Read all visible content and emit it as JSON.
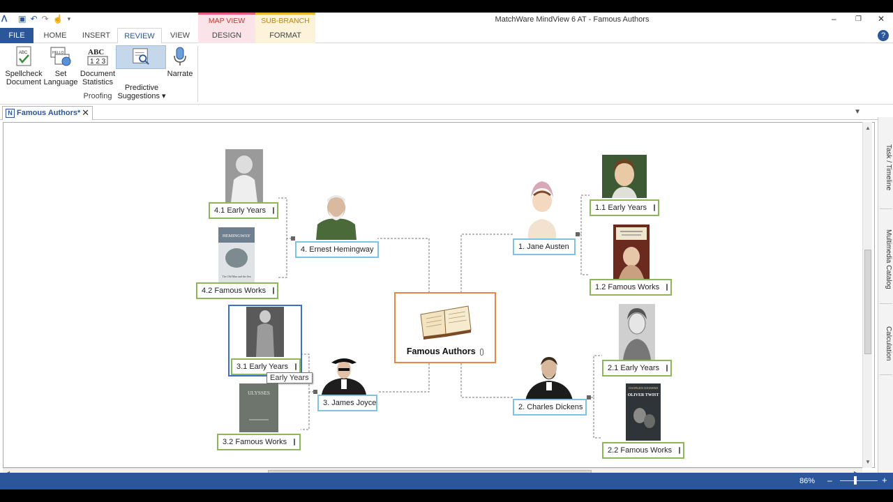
{
  "window": {
    "title": "MatchWare MindView 6 AT - Famous Authors",
    "context_tabs": {
      "map_view": "MAP VIEW",
      "sub_branch": "SUB-BRANCH"
    }
  },
  "ribbon_tabs": [
    "FILE",
    "HOME",
    "INSERT",
    "REVIEW",
    "VIEW",
    "DESIGN",
    "FORMAT"
  ],
  "ribbon": {
    "buttons": [
      {
        "line1": "Spellcheck",
        "line2": "Document",
        "icon": "spellcheck-icon"
      },
      {
        "line1": "Set",
        "line2": "Language",
        "icon": "language-icon"
      },
      {
        "line1": "Document",
        "line2": "Statistics",
        "icon": "statistics-icon"
      },
      {
        "line1": "Predictive",
        "line2": "Suggestions ▾",
        "icon": "predictive-icon"
      },
      {
        "line1": "Narrate",
        "line2": "",
        "icon": "microphone-icon"
      }
    ],
    "group_label": "Proofing"
  },
  "doc_tab": {
    "label": "Famous Authors*"
  },
  "side_tabs": [
    "Task / Timeline",
    "Multimedia Catalog",
    "Calculation"
  ],
  "map": {
    "central": "Famous Authors",
    "nodes": {
      "n1": "1.  Jane Austen",
      "n11": "1.1  Early Years",
      "n12": "1.2  Famous Works",
      "n2": "2.  Charles Dickens",
      "n21": "2.1  Early Years",
      "n22": "2.2  Famous Works",
      "n3": "3.  James Joyce",
      "n31": "3.1  Early Years",
      "n32": "3.2  Famous Works",
      "n4": "4.  Ernest Hemingway",
      "n41": "4.1  Early Years",
      "n42": "4.2  Famous Works"
    },
    "book_covers": {
      "hemingway_title": "HEMINGWAY",
      "hemingway_sub": "The Old Man and the Sea",
      "ulysses_title": "ULYSSES",
      "dickens_title": "CHARLES DICKENS",
      "dickens_book": "OLIVER TWIST"
    },
    "tooltip": "Early Years"
  },
  "status": {
    "zoom": "86%",
    "zoom_level": 0.5
  },
  "colors": {
    "brand": "#2b579a",
    "sub_branch_border": "#8db65a",
    "main_branch_border": "#7ec3e6",
    "central_border": "#e8864a",
    "selection": "#3c6fc8"
  }
}
